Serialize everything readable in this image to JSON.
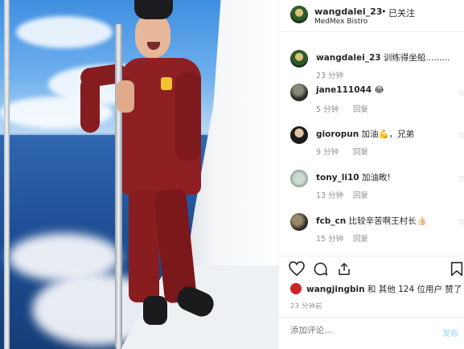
{
  "post": {
    "username": "wangdalei_23",
    "separator": "•",
    "follow_label": "已关注",
    "location": "MedMex Bistro"
  },
  "caption": {
    "username": "wangdalei_23",
    "text": "训练得坐船.........",
    "time": "23 分钟"
  },
  "comments": [
    {
      "username": "jane111044",
      "text": "😂",
      "time": "5 分钟",
      "reply": "回复"
    },
    {
      "username": "gioropun",
      "text": "加油💪，兄弟",
      "time": "9 分钟",
      "reply": "回复"
    },
    {
      "username": "tony_li10",
      "text": "加油畋!",
      "time": "13 分钟",
      "reply": "回复"
    },
    {
      "username": "fcb_cn",
      "text": "比较辛苦啊王村长👍🏻",
      "time": "15 分钟",
      "reply": "回复"
    }
  ],
  "actions": {
    "like_icon": "heart-icon",
    "comment_icon": "comment-icon",
    "share_icon": "share-icon",
    "save_icon": "bookmark-icon"
  },
  "likes": {
    "user": "wangjingbin",
    "rest": "和 其他 124 位用户 赞了"
  },
  "post_time": "23 分钟前",
  "add_comment": {
    "placeholder": "添加评论...",
    "post_label": "发布"
  }
}
